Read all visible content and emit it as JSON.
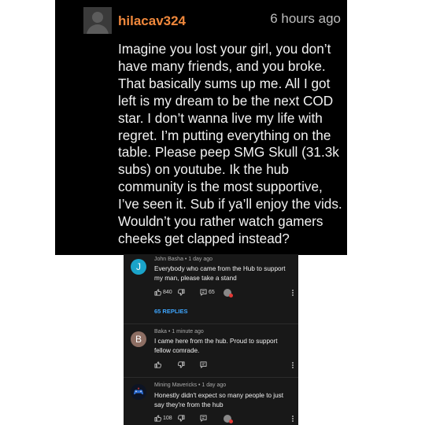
{
  "top_comment": {
    "username": "hilacav324",
    "time": "6 hours ago",
    "body": "Imagine you lost your girl, you don’t have many friends, and you broke. That basically sums up me. All I got left is my dream to be the next COD star. I don’t wanna live my life with regret. I’m putting everything on the table. Please peep SMG Skull (31.3k subs) on youtube. Ik the hub community is the most supportive, I’ve seen it. Sub if ya’ll enjoy the vids. Wouldn’t you rather watch gamers cheeks get clapped instead?",
    "colors": {
      "username": "#f0883c",
      "background": "#000000"
    }
  },
  "thread": {
    "background": "#181818",
    "comments": [
      {
        "avatar_letter": "J",
        "avatar_color": "#1aa3c9",
        "meta": "John Basha • 1 day ago",
        "text": "Everybody who came from the Hub to support my man, please take a stand",
        "likes": "840",
        "replies_count": "65",
        "replies_link": "65 REPLIES"
      },
      {
        "avatar_letter": "B",
        "avatar_color": "#8d6e63",
        "meta": "Baka • 1 minute ago",
        "text": "I came here from the hub. Proud to support fellow comrade."
      },
      {
        "avatar_letter": "",
        "avatar_icon": "gamepad-logo-icon",
        "meta": "Mining Mavericks • 1 day ago",
        "text": "Honestly didn't expect so many people to just say they're from the hub",
        "likes": "108"
      }
    ]
  }
}
